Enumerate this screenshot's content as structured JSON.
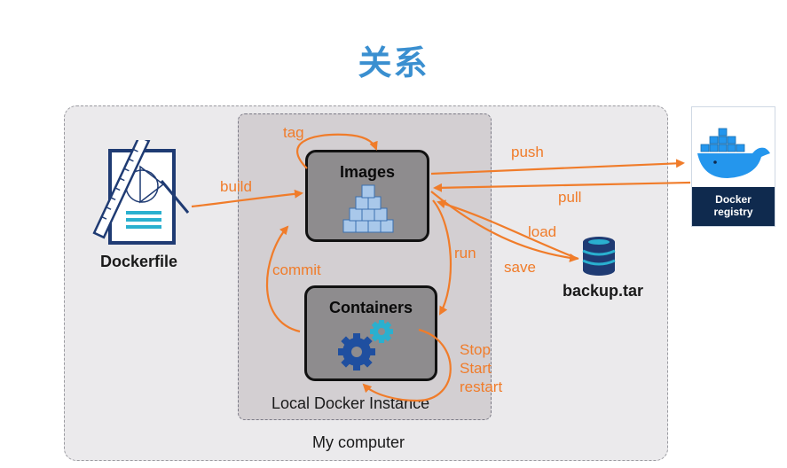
{
  "title": "关系",
  "containers": {
    "my_computer": "My computer",
    "local_instance": "Local Docker Instance"
  },
  "nodes": {
    "dockerfile": "Dockerfile",
    "images": "Images",
    "containers": "Containers",
    "backup": "backup.tar",
    "registry_line1": "Docker",
    "registry_line2": "registry"
  },
  "edges": {
    "tag": "tag",
    "build": "build",
    "push": "push",
    "pull": "pull",
    "load": "load",
    "save": "save",
    "run": "run",
    "commit": "commit",
    "stop": "Stop",
    "start": "Start",
    "restart": "restart"
  },
  "colors": {
    "arrow": "#f07c2a",
    "title": "#3a8fd0",
    "registry_bg": "#0f2a4e",
    "whale": "#2496ed"
  }
}
